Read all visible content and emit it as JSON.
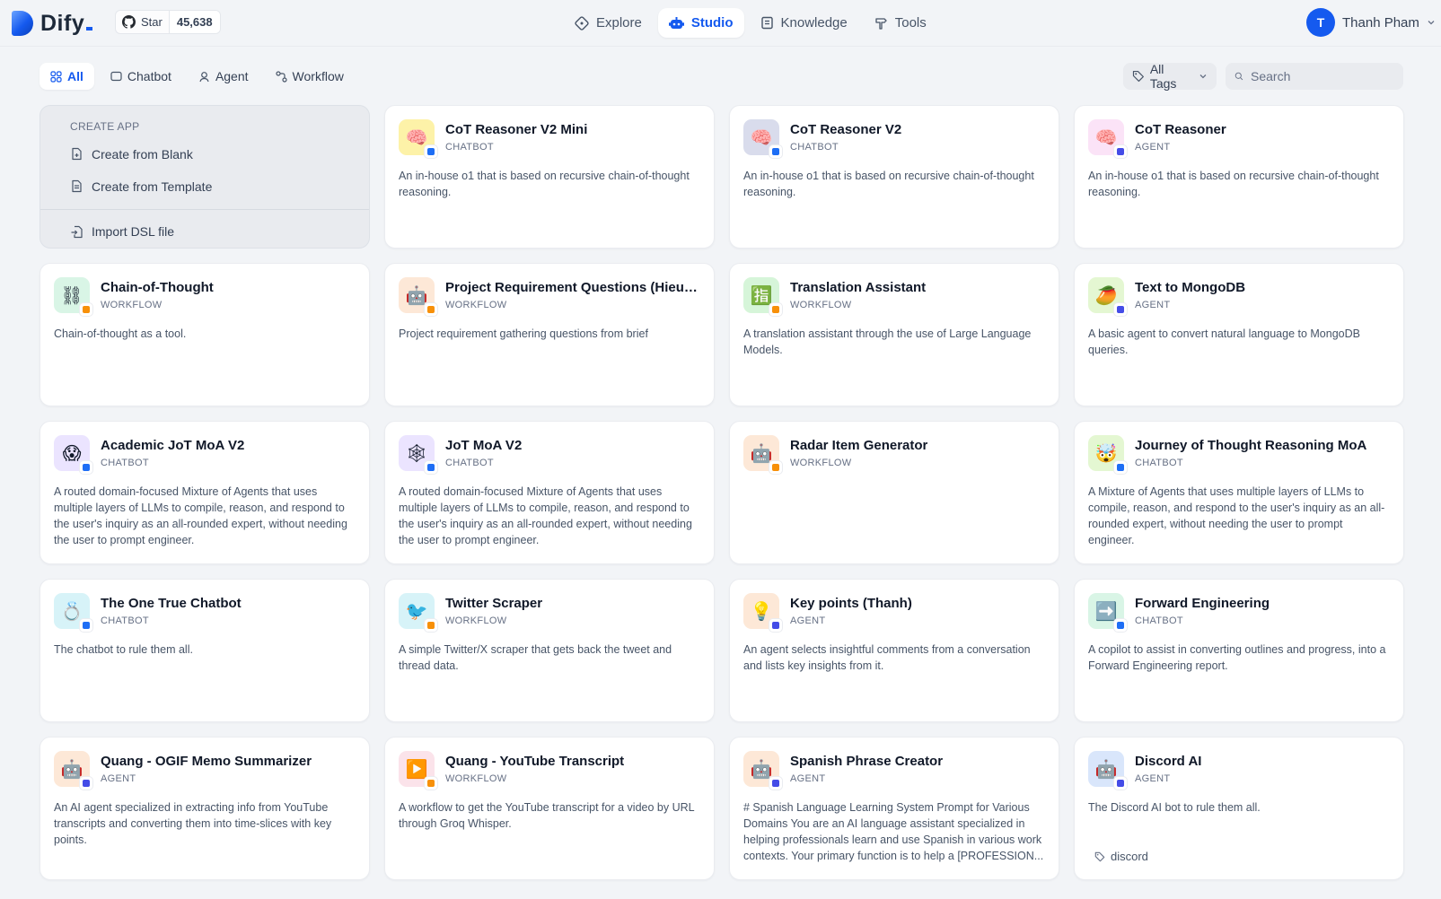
{
  "header": {
    "logo_text": "Dify",
    "github": {
      "star_label": "Star",
      "star_count": "45,638"
    },
    "nav": [
      {
        "label": "Explore",
        "icon": "compass-icon"
      },
      {
        "label": "Studio",
        "icon": "robot-icon",
        "active": true
      },
      {
        "label": "Knowledge",
        "icon": "book-icon"
      },
      {
        "label": "Tools",
        "icon": "hammer-icon"
      }
    ],
    "user": {
      "initial": "T",
      "name": "Thanh Pham"
    }
  },
  "filters": {
    "tabs": [
      {
        "label": "All",
        "active": true
      },
      {
        "label": "Chatbot"
      },
      {
        "label": "Agent"
      },
      {
        "label": "Workflow"
      }
    ],
    "tags_label": "All Tags",
    "search_placeholder": "Search"
  },
  "create_app": {
    "title": "CREATE APP",
    "items": [
      "Create from Blank",
      "Create from Template",
      "Import DSL file"
    ]
  },
  "colors": {
    "accent": "#155aef",
    "chatbot_badge": "#1e6ef5",
    "agent_badge": "#444ce7",
    "workflow_badge": "#f79009"
  },
  "apps": [
    {
      "name": "CoT Reasoner V2 Mini",
      "type": "CHATBOT",
      "icon": "🧠",
      "bg": "#fdf2a8",
      "desc": "An in-house o1 that is based on recursive chain-of-thought reasoning."
    },
    {
      "name": "CoT Reasoner V2",
      "type": "CHATBOT",
      "icon": "🧠",
      "bg": "#d9dcec",
      "desc": "An in-house o1 that is based on recursive chain-of-thought reasoning."
    },
    {
      "name": "CoT Reasoner",
      "type": "AGENT",
      "icon": "🧠",
      "bg": "#fbe3f7",
      "desc": "An in-house o1 that is based on recursive chain-of-thought reasoning."
    },
    {
      "name": "Chain-of-Thought",
      "type": "WORKFLOW",
      "icon": "⛓",
      "bg": "#d9f5e6",
      "desc": "Chain-of-thought as a tool."
    },
    {
      "name": "Project Requirement Questions (Hieu Te...",
      "type": "WORKFLOW",
      "icon": "🤖",
      "bg": "#fde8d7",
      "desc": "Project requirement gathering questions from brief"
    },
    {
      "name": "Translation Assistant",
      "type": "WORKFLOW",
      "icon": "🈯",
      "bg": "#d6f5d9",
      "desc": "A translation assistant through the use of Large Language Models."
    },
    {
      "name": "Text to MongoDB",
      "type": "AGENT",
      "icon": "🥭",
      "bg": "#e4f7d2",
      "desc": "A basic agent to convert natural language to MongoDB queries."
    },
    {
      "name": "Academic JoT MoA V2",
      "type": "CHATBOT",
      "icon": "😱",
      "bg": "#ebe4ff",
      "desc": "A routed domain-focused Mixture of Agents that uses multiple layers of LLMs to compile, reason, and respond to the user's inquiry as an all-rounded expert, without needing the user to prompt engineer."
    },
    {
      "name": "JoT MoA V2",
      "type": "CHATBOT",
      "icon": "🕸",
      "bg": "#ebe4ff",
      "desc": "A routed domain-focused Mixture of Agents that uses multiple layers of LLMs to compile, reason, and respond to the user's inquiry as an all-rounded expert, without needing the user to prompt engineer."
    },
    {
      "name": "Radar Item Generator",
      "type": "WORKFLOW",
      "icon": "🤖",
      "bg": "#fde8d7",
      "desc": ""
    },
    {
      "name": "Journey of Thought Reasoning MoA",
      "type": "CHATBOT",
      "icon": "🤯",
      "bg": "#e4f7d2",
      "desc": "A Mixture of Agents that uses multiple layers of LLMs to compile, reason, and respond to the user's inquiry as an all-rounded expert, without needing the user to prompt engineer."
    },
    {
      "name": "The One True Chatbot",
      "type": "CHATBOT",
      "icon": "💍",
      "bg": "#d7f3f8",
      "desc": "The chatbot to rule them all."
    },
    {
      "name": "Twitter Scraper",
      "type": "WORKFLOW",
      "icon": "🐦",
      "bg": "#d7f3f8",
      "desc": "A simple Twitter/X scraper that gets back the tweet and thread data."
    },
    {
      "name": "Key points (Thanh)",
      "type": "AGENT",
      "icon": "💡",
      "bg": "#fde8d7",
      "desc": "An agent selects insightful comments from a conversation and lists key insights from it."
    },
    {
      "name": "Forward Engineering",
      "type": "CHATBOT",
      "icon": "➡️",
      "bg": "#d9f5e6",
      "desc": "A copilot to assist in converting outlines and progress, into a Forward Engineering report."
    },
    {
      "name": "Quang - OGIF Memo Summarizer",
      "type": "AGENT",
      "icon": "🤖",
      "bg": "#fde8d7",
      "desc": "An AI agent specialized in extracting info from YouTube transcripts and converting them into time-slices with key points."
    },
    {
      "name": "Quang - YouTube Transcript",
      "type": "WORKFLOW",
      "icon": "▶️",
      "bg": "#fbe3ea",
      "desc": "A workflow to get the YouTube transcript for a video by URL through Groq Whisper."
    },
    {
      "name": "Spanish Phrase Creator",
      "type": "AGENT",
      "icon": "🤖",
      "bg": "#fde8d7",
      "desc": "# Spanish Language Learning System Prompt for Various Domains You are an AI language assistant specialized in helping professionals learn and use Spanish in various work contexts. Your primary function is to help a [PROFESSION..."
    },
    {
      "name": "Discord AI",
      "type": "AGENT",
      "icon": "🤖",
      "bg": "#d9e6fb",
      "desc": "The Discord AI bot to rule them all.",
      "tag": "discord"
    }
  ]
}
